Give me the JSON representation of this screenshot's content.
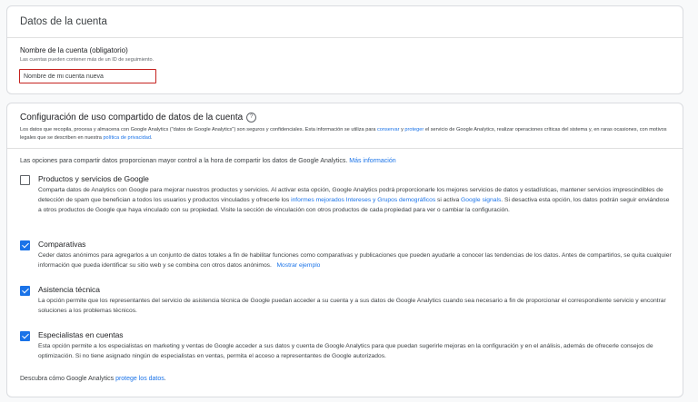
{
  "account": {
    "section_title": "Datos de la cuenta",
    "name_label": "Nombre de la cuenta (obligatorio)",
    "name_help": "Las cuentas pueden contener más de un ID de seguimiento.",
    "name_placeholder": "Nombre de mi cuenta nueva"
  },
  "sharing": {
    "title": "Configuración de uso compartido de datos de la cuenta",
    "help_icon": "help-circle-icon",
    "desc": {
      "p1": "Los datos que recopila, procesa y almacena con Google Analytics (\"datos de Google Analytics\") son seguros y confidenciales. Esta información se utiliza para ",
      "link1": "conservar",
      "p2": " y ",
      "link2": "proteger",
      "p3": " el servicio de Google Analytics, realizar operaciones críticas del sistema y, en raras ocasiones, con motivos legales que se describen en nuestra ",
      "link3": "política de privacidad",
      "p4": "."
    },
    "intro": {
      "text": "Las opciones para compartir datos proporcionan mayor control a la hora de compartir los datos de Google Analytics. ",
      "link": "Más información"
    },
    "options": [
      {
        "title": "Productos y servicios de Google",
        "checked": false,
        "d1": "Comparta datos de Analytics con Google para mejorar nuestros productos y servicios. Al activar esta opción, Google Analytics podrá proporcionarle los mejores servicios de datos y estadísticas, mantener servicios imprescindibles de detección de spam que benefician a todos los usuarios y productos vinculados y ofrecerle los ",
        "link1": "informes mejorados Intereses y Grupos demográficos",
        "d2": " si activa ",
        "link2": "Google signals",
        "d3": ". Si desactiva esta opción, los datos podrán seguir enviándose a otros productos de Google que haya vinculado con su propiedad. Visite la sección de vinculación con otros productos de cada propiedad para ver o cambiar la configuración."
      },
      {
        "title": "Comparativas",
        "checked": true,
        "d1": "Ceder datos anónimos para agregarlos a un conjunto de datos totales a fin de habilitar funciones como comparativas y publicaciones que pueden ayudarle a conocer las tendencias de los datos. Antes de compartirlos, se quita cualquier información que pueda identificar su sitio web y se combina con otros datos anónimos.",
        "link1": "Mostrar ejemplo"
      },
      {
        "title": "Asistencia técnica",
        "checked": true,
        "d1": "La opción permite que los representantes del servicio de asistencia técnica de Google puedan acceder a su cuenta y a sus datos de Google Analytics cuando sea necesario a fin de proporcionar el correspondiente servicio y encontrar soluciones a los problemas técnicos."
      },
      {
        "title": "Especialistas en cuentas",
        "checked": true,
        "d1": "Esta opción permite a los especialistas en marketing y ventas de Google acceder a sus datos y cuenta de Google Analytics para que puedan sugerirle mejoras en la configuración y en el análisis, además de ofrecerle consejos de optimización. Si no tiene asignado ningún de especialistas en ventas, permita el acceso a representantes de Google autorizados."
      }
    ],
    "footer": {
      "text": "Descubra cómo Google Analytics ",
      "link": "protege los datos",
      "end": "."
    }
  },
  "colors": {
    "link": "#1a73e8",
    "checkbox_checked": "#1a73e8",
    "input_error_border": "#c5221f"
  }
}
